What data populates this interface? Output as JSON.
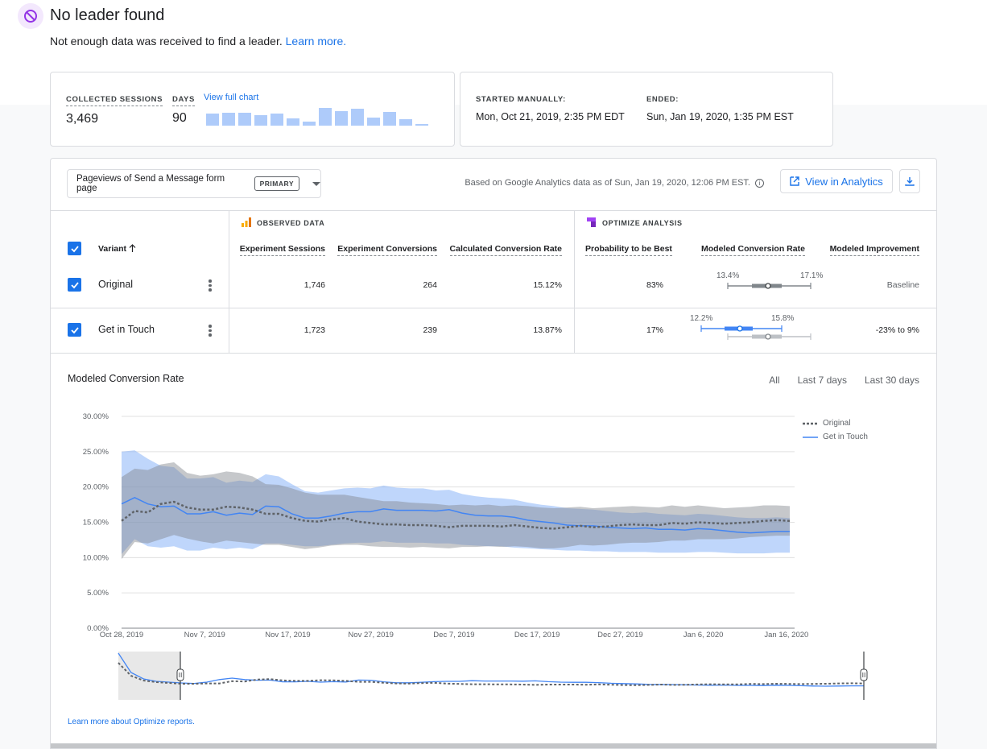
{
  "banner": {
    "icon": "block-icon",
    "title": "No leader found",
    "subtitle": "Not enough data was received to find a leader.",
    "learn_more": "Learn more."
  },
  "summary": {
    "collected_sessions_label": "COLLECTED SESSIONS",
    "collected_sessions": "3,469",
    "days_label": "DAYS",
    "days": "90",
    "view_full_chart": "View full chart",
    "sparkline": [
      0.62,
      0.66,
      0.66,
      0.55,
      0.63,
      0.37,
      0.2,
      0.93,
      0.75,
      0.87,
      0.42,
      0.72,
      0.32,
      0.08
    ]
  },
  "schedule": {
    "started_label": "STARTED MANUALLY:",
    "started": "Mon, Oct 21, 2019, 2:35 PM EDT",
    "ended_label": "ENDED:",
    "ended": "Sun, Jan 19, 2020, 1:35 PM EST"
  },
  "toolbar": {
    "objective": "Pageviews of Send a Message form page",
    "objective_chip": "PRIMARY",
    "based_on": "Based on Google Analytics data as of Sun, Jan 19, 2020, 12:06 PM EST.",
    "view_in_analytics": "View in Analytics"
  },
  "table": {
    "observed_header": "OBSERVED DATA",
    "optimize_header": "OPTIMIZE ANALYSIS",
    "columns": {
      "variant": "Variant",
      "sessions": "Experiment Sessions",
      "conversions": "Experiment Conversions",
      "conv_rate": "Calculated Conversion Rate",
      "prob_best": "Probability to be Best",
      "modeled_rate": "Modeled Conversion Rate",
      "improvement": "Modeled Improvement"
    },
    "rows": [
      {
        "name": "Original",
        "sessions": "1,746",
        "conversions": "264",
        "conv_rate": "15.12%",
        "prob_best": "83%",
        "range_low": "13.4%",
        "range_high": "17.1%",
        "improvement": "Baseline"
      },
      {
        "name": "Get in Touch",
        "sessions": "1,723",
        "conversions": "239",
        "conv_rate": "13.87%",
        "prob_best": "17%",
        "range_low": "12.2%",
        "range_high": "15.8%",
        "improvement": "-23% to 9%"
      }
    ]
  },
  "chart_section": {
    "title": "Modeled Conversion Rate",
    "tabs": [
      "All",
      "Last 7 days",
      "Last 30 days"
    ],
    "footer_link": "Learn more about Optimize reports."
  },
  "colors": {
    "original": "#5f6368",
    "get_in_touch": "#4285f4",
    "accent": "#1a73e8"
  },
  "chart_data": {
    "type": "line",
    "title": "Modeled Conversion Rate",
    "ylim": [
      0,
      30
    ],
    "yticks": [
      "30.00%",
      "25.00%",
      "20.00%",
      "15.00%",
      "10.00%",
      "5.00%",
      "0.00%"
    ],
    "x_tick_labels": [
      "Oct 28, 2019",
      "Nov 7, 2019",
      "Nov 17, 2019",
      "Nov 27, 2019",
      "Dec 7, 2019",
      "Dec 17, 2019",
      "Dec 27, 2019",
      "Jan 6, 2020",
      "Jan 16, 2020"
    ],
    "x_start": "Oct 28, 2019",
    "x_end": "Jan 19, 2020",
    "grid": true,
    "legend_position": "top-right",
    "series": [
      {
        "name": "Original",
        "style": "dotted",
        "values": [
          15.2,
          16.6,
          16.4,
          17.6,
          17.9,
          17.1,
          16.8,
          16.8,
          17.2,
          17.1,
          16.8,
          16.2,
          16.2,
          15.6,
          15.2,
          15.1,
          15.4,
          15.6,
          15.1,
          14.9,
          14.7,
          14.7,
          14.6,
          14.6,
          14.5,
          14.3,
          14.5,
          14.5,
          14.5,
          14.4,
          14.6,
          14.4,
          14.2,
          14.1,
          14.3,
          14.5,
          14.3,
          14.4,
          14.6,
          14.7,
          14.6,
          14.6,
          14.9,
          14.8,
          15.0,
          14.9,
          14.8,
          14.9,
          15.0,
          15.2,
          15.3,
          15.2
        ],
        "lower": [
          9.8,
          12.2,
          12.0,
          12.6,
          13.2,
          12.7,
          12.3,
          12.0,
          12.4,
          12.2,
          12.0,
          11.8,
          11.8,
          11.5,
          11.2,
          11.4,
          11.7,
          11.8,
          11.8,
          11.6,
          11.5,
          11.5,
          11.4,
          11.5,
          11.4,
          11.3,
          11.5,
          11.5,
          11.6,
          11.5,
          11.6,
          11.5,
          11.3,
          11.3,
          11.5,
          11.8,
          11.7,
          11.8,
          12.0,
          12.1,
          12.1,
          12.2,
          12.4,
          12.4,
          12.6,
          12.6,
          12.6,
          12.7,
          12.9,
          13.0,
          13.1,
          13.1
        ],
        "upper": [
          21.4,
          22.6,
          22.4,
          23.2,
          23.5,
          22.0,
          21.6,
          21.8,
          22.2,
          22.0,
          21.5,
          20.4,
          20.3,
          19.8,
          19.2,
          18.9,
          18.9,
          18.9,
          18.6,
          18.3,
          18.0,
          18.0,
          17.8,
          17.7,
          17.6,
          17.4,
          17.5,
          17.4,
          17.5,
          17.3,
          17.4,
          17.3,
          17.1,
          17.0,
          17.1,
          17.2,
          17.0,
          17.1,
          17.2,
          17.3,
          17.2,
          17.1,
          17.4,
          17.2,
          17.4,
          17.2,
          17.0,
          17.1,
          17.2,
          17.4,
          17.4,
          17.3
        ]
      },
      {
        "name": "Get in Touch",
        "style": "solid",
        "values": [
          17.6,
          18.5,
          17.6,
          17.2,
          17.3,
          16.2,
          16.2,
          16.5,
          16.0,
          16.3,
          16.1,
          17.3,
          17.2,
          16.2,
          15.6,
          15.6,
          15.9,
          16.3,
          16.5,
          16.5,
          16.9,
          16.7,
          16.7,
          16.7,
          16.6,
          16.8,
          16.3,
          16.0,
          15.9,
          15.9,
          15.7,
          15.3,
          15.1,
          14.9,
          14.6,
          14.5,
          14.5,
          14.3,
          14.2,
          14.1,
          14.2,
          14.0,
          14.0,
          13.9,
          14.1,
          14.0,
          13.8,
          13.6,
          13.5,
          13.6,
          13.7,
          13.7
        ],
        "lower": [
          10.5,
          12.6,
          11.6,
          11.4,
          11.6,
          11.0,
          11.0,
          11.4,
          11.2,
          11.4,
          11.2,
          12.0,
          12.0,
          11.8,
          11.6,
          11.6,
          11.8,
          12.0,
          12.1,
          12.1,
          12.3,
          12.1,
          12.1,
          12.1,
          12.0,
          12.0,
          11.8,
          11.7,
          11.6,
          11.6,
          11.4,
          11.3,
          11.2,
          11.1,
          11.0,
          11.0,
          10.9,
          10.9,
          10.8,
          10.8,
          10.8,
          10.7,
          10.7,
          10.7,
          10.8,
          10.8,
          10.7,
          10.6,
          10.6,
          10.6,
          10.7,
          10.7
        ],
        "upper": [
          25.0,
          25.2,
          24.0,
          23.0,
          22.8,
          21.2,
          21.2,
          21.4,
          20.6,
          20.9,
          20.7,
          21.8,
          21.5,
          20.4,
          19.4,
          19.2,
          19.5,
          19.8,
          19.9,
          19.8,
          20.2,
          19.9,
          19.8,
          19.8,
          19.5,
          19.6,
          19.0,
          18.7,
          18.5,
          18.4,
          18.2,
          17.8,
          17.5,
          17.3,
          17.0,
          16.9,
          16.8,
          16.6,
          16.4,
          16.3,
          16.4,
          16.2,
          16.1,
          16.0,
          16.2,
          16.1,
          15.9,
          15.7,
          15.6,
          15.6,
          15.7,
          15.6
        ]
      }
    ]
  }
}
